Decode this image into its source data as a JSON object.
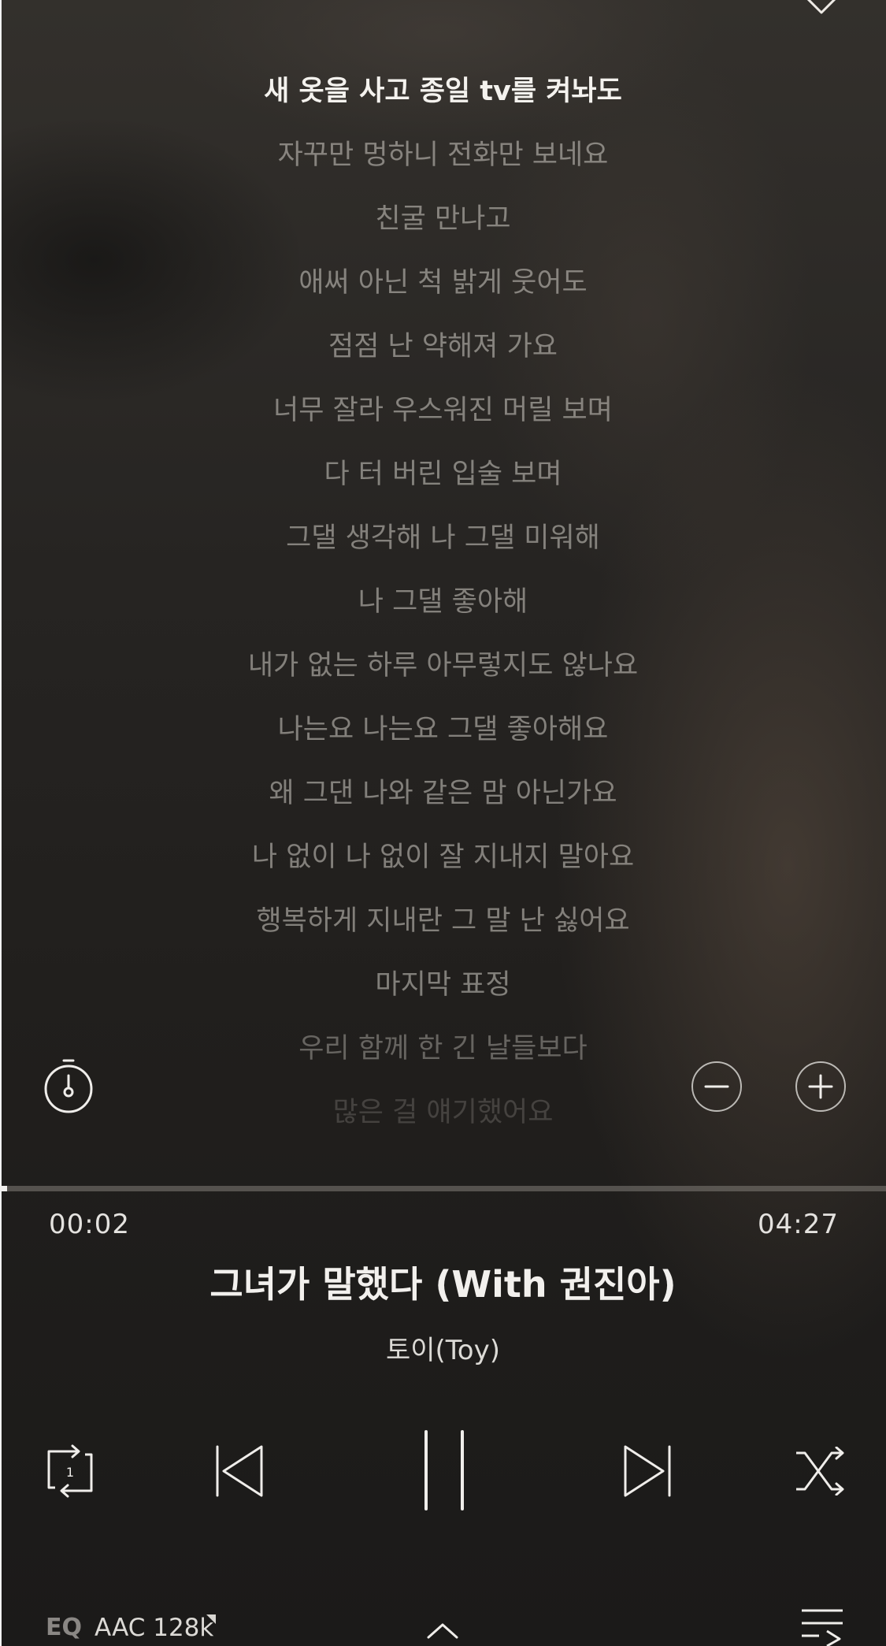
{
  "lyrics": {
    "lines": [
      "새 옷을 사고 종일 tv를 켜놔도",
      "자꾸만 멍하니 전화만 보네요",
      "친굴 만나고",
      "애써 아닌 척 밝게 웃어도",
      "점점 난 약해져 가요",
      "너무 잘라 우스워진 머릴 보며",
      "다 터 버린 입술 보며",
      "그댈 생각해 나 그댈 미워해",
      "나 그댈 좋아해",
      "내가 없는 하루 아무렇지도 않나요",
      "나는요 나는요 그댈 좋아해요",
      "왜 그댄 나와 같은 맘 아닌가요",
      "나 없이 나 없이 잘 지내지 말아요",
      "행복하게 지내란 그 말 난 싫어요",
      "마지막 표정",
      "우리 함께 한 긴 날들보다",
      "많은 걸 얘기했어요"
    ]
  },
  "player": {
    "elapsed": "00:02",
    "duration": "04:27",
    "progress_fraction": 0.008,
    "title": "그녀가 말했다 (With 권진아)",
    "artist": "토이(Toy)",
    "repeat_badge": "1"
  },
  "footer": {
    "eq_label": "EQ",
    "codec_label": "AAC 128k"
  },
  "icons": {
    "like": "heart-icon",
    "timer": "timer-icon",
    "font_smaller": "minus-icon",
    "font_larger": "plus-icon",
    "repeat": "repeat-one-icon",
    "previous": "previous-icon",
    "pause": "pause-icon",
    "next": "next-icon",
    "shuffle": "shuffle-icon",
    "expand": "chevron-up-icon",
    "playlist": "playlist-icon"
  }
}
